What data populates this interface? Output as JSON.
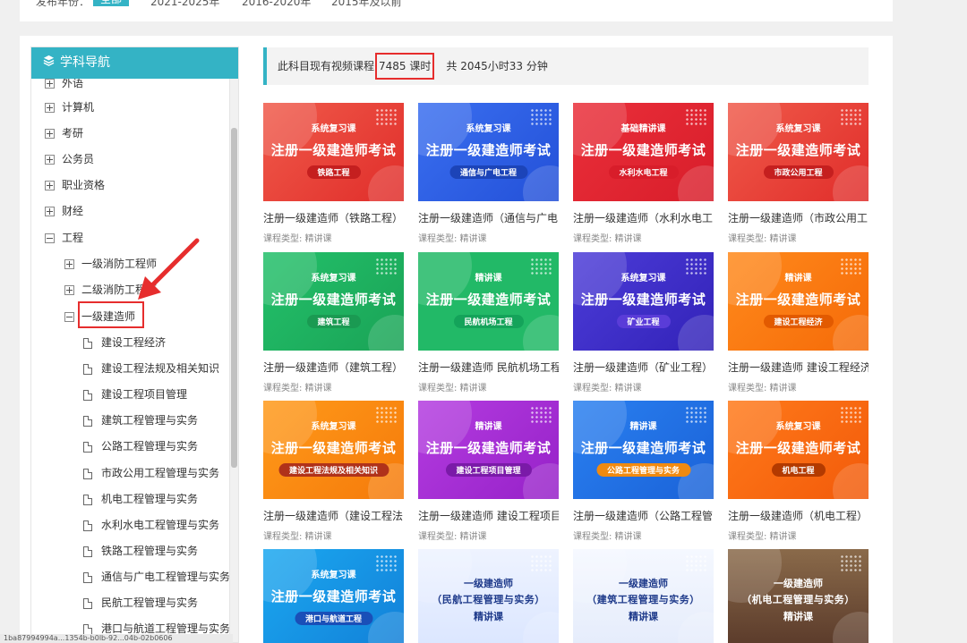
{
  "filter": {
    "label": "发布年份：",
    "options": [
      "全部",
      "2021-2025年",
      "2016-2020年",
      "2015年及以前"
    ]
  },
  "sidebar": {
    "title": "学科导航",
    "categories": [
      {
        "label": "外语"
      },
      {
        "label": "计算机"
      },
      {
        "label": "考研"
      },
      {
        "label": "公务员"
      },
      {
        "label": "职业资格"
      },
      {
        "label": "财经"
      },
      {
        "label": "工程"
      }
    ],
    "sub_categories": [
      {
        "label": "一级消防工程师"
      },
      {
        "label": "二级消防工程师"
      },
      {
        "label": "一级建造师"
      }
    ],
    "leaves": [
      {
        "label": "建设工程经济"
      },
      {
        "label": "建设工程法规及相关知识"
      },
      {
        "label": "建设工程项目管理"
      },
      {
        "label": "建筑工程管理与实务"
      },
      {
        "label": "公路工程管理与实务"
      },
      {
        "label": "市政公用工程管理与实务"
      },
      {
        "label": "机电工程管理与实务"
      },
      {
        "label": "水利水电工程管理与实务"
      },
      {
        "label": "铁路工程管理与实务"
      },
      {
        "label": "通信与广电工程管理与实务"
      },
      {
        "label": "民航工程管理与实务"
      },
      {
        "label": "港口与航道工程管理与实务"
      }
    ]
  },
  "info": {
    "prefix": "此科目现有视频课程",
    "count": "7485 课时",
    "total": "共 2045小时33 分钟"
  },
  "course_type_label": "课程类型: 精讲课",
  "courses": [
    {
      "title": "注册一级建造师（铁路工程）",
      "tag": "系统复习课",
      "main": "注册一级建造师考试",
      "sub": "铁路工程"
    },
    {
      "title": "注册一级建造师（通信与广电",
      "tag": "系统复习课",
      "main": "注册一级建造师考试",
      "sub": "通信与广电工程"
    },
    {
      "title": "注册一级建造师（水利水电工",
      "tag": "基础精讲课",
      "main": "注册一级建造师考试",
      "sub": "水利水电工程"
    },
    {
      "title": "注册一级建造师（市政公用工",
      "tag": "系统复习课",
      "main": "注册一级建造师考试",
      "sub": "市政公用工程"
    },
    {
      "title": "注册一级建造师（建筑工程）",
      "tag": "系统复习课",
      "main": "注册一级建造师考试",
      "sub": "建筑工程"
    },
    {
      "title": "注册一级建造师 民航机场工程-",
      "tag": "精讲课",
      "main": "注册一级建造师考试",
      "sub": "民航机场工程"
    },
    {
      "title": "注册一级建造师（矿业工程）",
      "tag": "系统复习课",
      "main": "注册一级建造师考试",
      "sub": "矿业工程"
    },
    {
      "title": "注册一级建造师 建设工程经济-",
      "tag": "精讲课",
      "main": "注册一级建造师考试",
      "sub": "建设工程经济"
    },
    {
      "title": "注册一级建造师（建设工程法",
      "tag": "系统复习课",
      "main": "注册一级建造师考试",
      "sub": "建设工程法规及相关知识"
    },
    {
      "title": "注册一级建造师 建设工程项目",
      "tag": "精讲课",
      "main": "注册一级建造师考试",
      "sub": "建设工程项目管理"
    },
    {
      "title": "注册一级建造师（公路工程管",
      "tag": "精讲课",
      "main": "注册一级建造师考试",
      "sub": "公路工程管理与实务"
    },
    {
      "title": "注册一级建造师（机电工程）",
      "tag": "系统复习课",
      "main": "注册一级建造师考试",
      "sub": "机电工程"
    },
    {
      "title": "",
      "tag": "系统复习课",
      "main": "注册一级建造师考试",
      "sub": "港口与航道工程"
    },
    {
      "title": "",
      "tag": "一级建造师",
      "main": "（民航工程管理与实务）",
      "sub": "精讲课"
    },
    {
      "title": "",
      "tag": "一级建造师",
      "main": "（建筑工程管理与实务）",
      "sub": "精讲课"
    },
    {
      "title": "",
      "tag": "一级建造师",
      "main": "（机电工程管理与实务）",
      "sub": "精讲课"
    }
  ],
  "status_bar": "1ba87994994a...1354b-b0lb-92...04b-02b0606"
}
